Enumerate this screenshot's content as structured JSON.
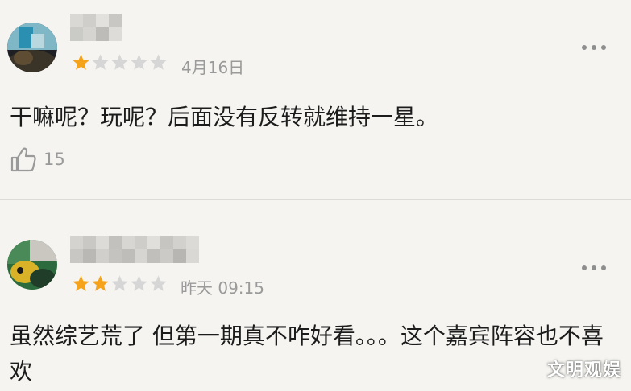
{
  "colors": {
    "background": "#f5f4f0",
    "star_filled": "#f5a31a",
    "star_empty": "#d6d6d6",
    "meta_text": "#9a9a9a",
    "divider": "#dcdbd7"
  },
  "reviews": [
    {
      "rating": 1,
      "max_rating": 5,
      "date": "4月16日",
      "text": "干嘛呢？玩呢？后面没有反转就维持一星。",
      "likes": "15",
      "avatar_icon": "user-avatar-icon",
      "more_icon": "more-options-icon"
    },
    {
      "rating": 2,
      "max_rating": 5,
      "date": "昨天 09:15",
      "text": "虽然综艺荒了 但第一期真不咋好看。。。这个嘉宾阵容也不喜欢",
      "avatar_icon": "user-avatar-icon",
      "more_icon": "more-options-icon"
    }
  ],
  "watermark": "文明观娱"
}
